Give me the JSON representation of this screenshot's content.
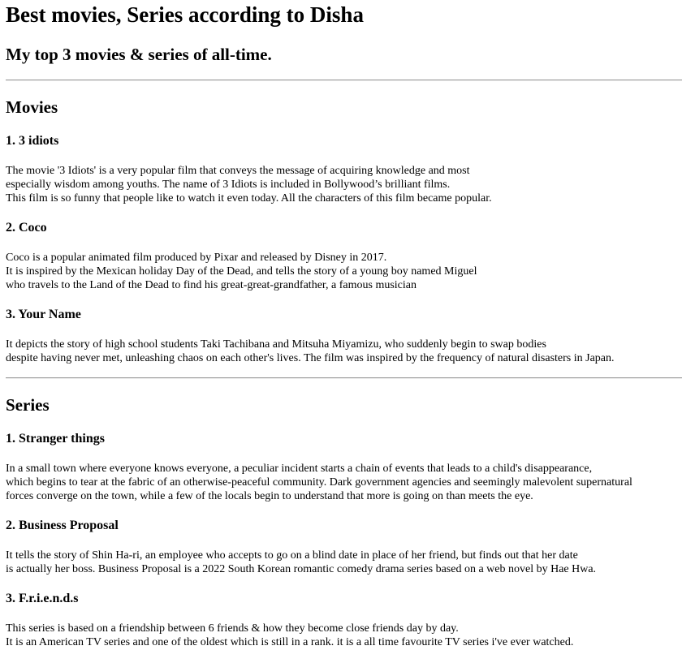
{
  "page": {
    "title": "Best movies, Series according to Disha",
    "tagline": "My top 3 movies & series of all-time."
  },
  "movies": {
    "heading": "Movies",
    "items": [
      {
        "title": "1. 3 idiots",
        "lines": [
          "The movie '3 Idiots' is a very popular film that conveys the message of acquiring knowledge and most",
          "especially wisdom among youths. The name of 3 Idiots is included in Bollywood’s brilliant films.",
          "This film is so funny that people like to watch it even today. All the characters of this film became popular."
        ]
      },
      {
        "title": "2. Coco",
        "lines": [
          "Coco is a popular animated film produced by Pixar and released by Disney in 2017.",
          "It is inspired by the Mexican holiday Day of the Dead, and tells the story of a young boy named Miguel",
          "who travels to the Land of the Dead to find his great-great-grandfather, a famous musician"
        ]
      },
      {
        "title": "3. Your Name",
        "lines": [
          "It depicts the story of high school students Taki Tachibana and Mitsuha Miyamizu, who suddenly begin to swap bodies",
          "despite having never met, unleashing chaos on each other's lives. The film was inspired by the frequency of natural disasters in Japan."
        ]
      }
    ]
  },
  "series": {
    "heading": "Series",
    "items": [
      {
        "title": "1. Stranger things",
        "lines": [
          "In a small town where everyone knows everyone, a peculiar incident starts a chain of events that leads to a child's disappearance,",
          "which begins to tear at the fabric of an otherwise-peaceful community. Dark government agencies and seemingly malevolent supernatural",
          "forces converge on the town, while a few of the locals begin to understand that more is going on than meets the eye."
        ]
      },
      {
        "title": "2. Business Proposal",
        "lines": [
          "It tells the story of Shin Ha-ri, an employee who accepts to go on a blind date in place of her friend, but finds out that her date",
          "is actually her boss. Business Proposal is a 2022 South Korean romantic comedy drama series based on a web novel by Hae Hwa."
        ]
      },
      {
        "title": "3. F.r.i.e.n.d.s",
        "lines": [
          "This series is based on a friendship between 6 friends & how they become close friends day by day.",
          "It is an American TV series and one of the oldest which is still in a rank. it is a all time favourite TV series i've ever watched."
        ]
      }
    ]
  }
}
